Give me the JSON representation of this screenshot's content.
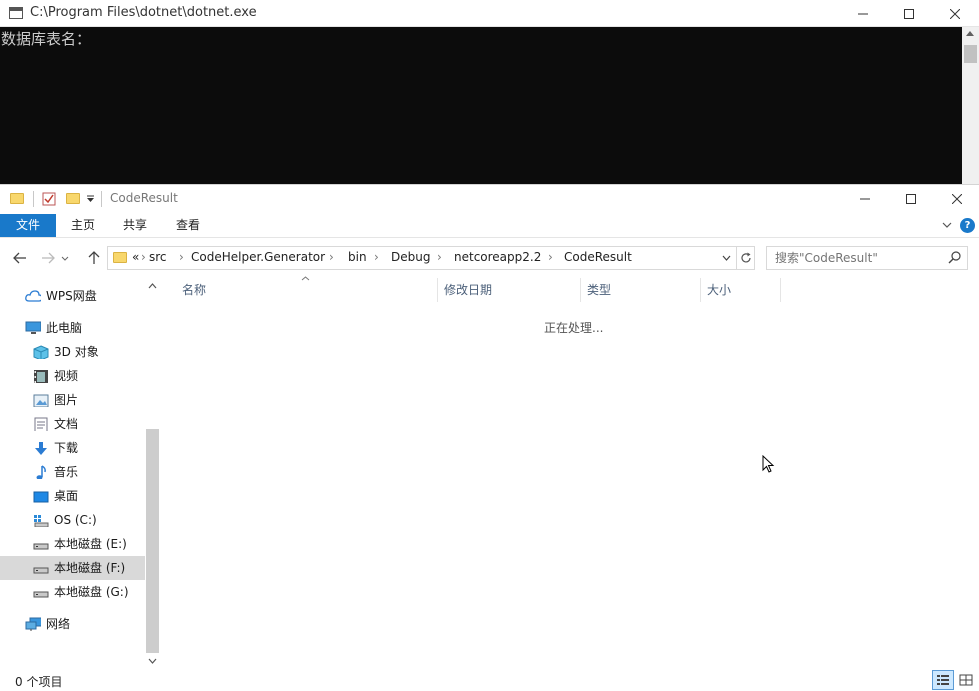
{
  "console": {
    "title": "C:\\Program Files\\dotnet\\dotnet.exe",
    "prompt_text": "数据库表名：",
    "icons": [
      "console-app-icon",
      "minimize-icon",
      "maximize-icon",
      "close-icon"
    ]
  },
  "explorer": {
    "title": "CodeResult",
    "ribbon": {
      "tabs": [
        "文件",
        "主页",
        "共享",
        "查看"
      ],
      "accent": "#1979ca",
      "help_glyph": "?"
    },
    "address": {
      "overflow": "«",
      "crumbs": [
        "src",
        "CodeHelper.Generator",
        "bin",
        "Debug",
        "netcoreapp2.2",
        "CodeResult"
      ]
    },
    "search": {
      "placeholder": "搜索\"CodeResult\""
    },
    "nav": {
      "items": [
        {
          "label": "WPS网盘",
          "icon": "cloud-icon"
        },
        {
          "label": "此电脑",
          "icon": "computer-icon"
        },
        {
          "label": "3D 对象",
          "icon": "3d-objects-icon"
        },
        {
          "label": "视频",
          "icon": "video-icon"
        },
        {
          "label": "图片",
          "icon": "pictures-icon"
        },
        {
          "label": "文档",
          "icon": "documents-icon"
        },
        {
          "label": "下载",
          "icon": "download-icon"
        },
        {
          "label": "音乐",
          "icon": "music-icon"
        },
        {
          "label": "桌面",
          "icon": "desktop-icon"
        },
        {
          "label": "OS (C:)",
          "icon": "os-drive-icon"
        },
        {
          "label": "本地磁盘 (E:)",
          "icon": "drive-icon"
        },
        {
          "label": "本地磁盘 (F:)",
          "icon": "drive-icon"
        },
        {
          "label": "本地磁盘 (G:)",
          "icon": "drive-icon"
        },
        {
          "label": "网络",
          "icon": "network-icon"
        }
      ],
      "selected": "本地磁盘 (F:)"
    },
    "columns": [
      "名称",
      "修改日期",
      "类型",
      "大小"
    ],
    "status_message": "正在处理...",
    "status_bar": {
      "item_count": "0 个项目"
    }
  }
}
